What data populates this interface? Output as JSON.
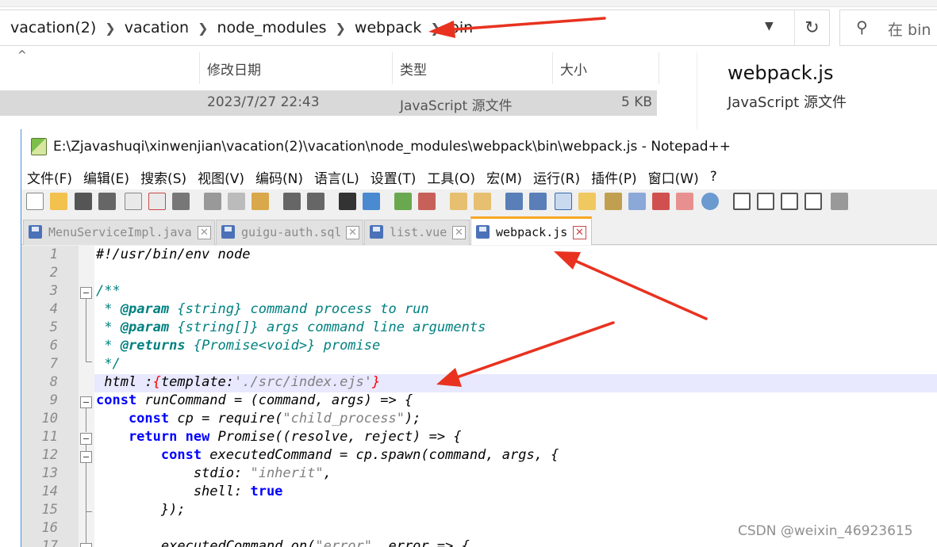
{
  "explorer": {
    "breadcrumb": [
      "vacation(2)",
      "vacation",
      "node_modules",
      "webpack",
      "bin"
    ],
    "search_placeholder": "在 bin 中",
    "columns": {
      "modified": "修改日期",
      "type": "类型",
      "size": "大小"
    },
    "file_row": {
      "modified": "2023/7/27 22:43",
      "type": "JavaScript 源文件",
      "size": "5 KB"
    },
    "preview": {
      "name": "webpack.js",
      "type": "JavaScript 源文件"
    }
  },
  "notepad": {
    "title": "E:\\Zjavashuqi\\xinwenjian\\vacation(2)\\vacation\\node_modules\\webpack\\bin\\webpack.js - Notepad++",
    "menu": [
      "文件(F)",
      "编辑(E)",
      "搜索(S)",
      "视图(V)",
      "编码(N)",
      "语言(L)",
      "设置(T)",
      "工具(O)",
      "宏(M)",
      "运行(R)",
      "插件(P)",
      "窗口(W)",
      "?"
    ],
    "tabs": [
      {
        "label": "MenuServiceImpl.java"
      },
      {
        "label": "guigu-auth.sql"
      },
      {
        "label": "list.vue"
      },
      {
        "label": "webpack.js",
        "active": true
      }
    ],
    "line_numbers": [
      "1",
      "2",
      "3",
      "4",
      "5",
      "6",
      "7",
      "8",
      "9",
      "10",
      "11",
      "12",
      "13",
      "14",
      "15",
      "16",
      "17"
    ],
    "code": {
      "l1": "#!/usr/bin/env node",
      "l3": "/**",
      "l4_star": " * ",
      "l4_tag": "@param",
      "l4_rest": " {string} command process to run",
      "l5_star": " * ",
      "l5_tag": "@param",
      "l5_rest": " {string[]} args command line arguments",
      "l6_star": " * ",
      "l6_tag": "@returns",
      "l6_rest": " {Promise<void>} promise",
      "l7": " */",
      "l8_a": " html :",
      "l8_b": "{",
      "l8_c": "template:",
      "l8_d": "'./src/index.ejs'",
      "l8_e": "}",
      "l9_kw": "const",
      "l9_a": " runCommand = (command, args) => {",
      "l10_kw": "    const",
      "l10_a": " cp = require(",
      "l10_str": "\"child_process\"",
      "l10_b": ");",
      "l11_kw1": "    return",
      "l11_kw2": " new",
      "l11_a": " Promise((resolve, reject) => {",
      "l12_kw": "        const",
      "l12_a": " executedCommand = cp.spawn(command, args, {",
      "l13_a": "            stdio: ",
      "l13_str": "\"inherit\"",
      "l13_b": ",",
      "l14_a": "            shell: ",
      "l14_kw": "true",
      "l15_a": "        });",
      "l17_a": "        executedCommand.on(",
      "l17_str": "\"error\"",
      "l17_b": ", error => {"
    }
  },
  "watermark": "CSDN @weixin_46923615"
}
